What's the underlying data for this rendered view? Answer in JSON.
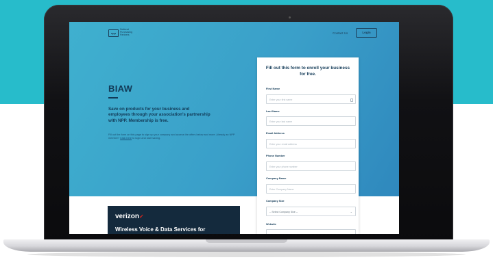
{
  "brand": {
    "logo_mark": "npp",
    "logo_line1": "National",
    "logo_line2": "Purchasing",
    "logo_line3": "Partners"
  },
  "nav": {
    "contact": "Contact Us",
    "login": "Login"
  },
  "hero": {
    "title": "BIAW",
    "lead": "Save on products for your business and employees through your association's partnership with NPP. Membership is free.",
    "small_before_link": "Fill out the form on this page to sign up your company and access the offers below and more. Already an NPP member?",
    "small_link": "Click here",
    "small_after_link": "to login and start saving."
  },
  "offer": {
    "brand": "verizon",
    "checkmark": "✓",
    "headline": "Wireless Voice & Data Services for"
  },
  "form": {
    "title": "Fill out this form to enroll your business for free.",
    "fields": [
      {
        "label": "First Name",
        "placeholder": "Enter your first name"
      },
      {
        "label": "Last Name",
        "placeholder": "Enter your last name"
      },
      {
        "label": "Email Address",
        "placeholder": "Enter your email address"
      },
      {
        "label": "Phone Number",
        "placeholder": "Enter your phone number"
      },
      {
        "label": "Company Name",
        "placeholder": "Enter Company Name"
      },
      {
        "label": "Company Size",
        "placeholder": "-- Select Company Size --"
      },
      {
        "label": "Website",
        "placeholder": ""
      }
    ]
  },
  "colors": {
    "page_band": "#27bccb",
    "hero_start": "#3fb0cf",
    "hero_end": "#2f88bd",
    "navy": "#123a57",
    "verizon_panel": "#142a3d",
    "verizon_check": "#e0241b"
  }
}
